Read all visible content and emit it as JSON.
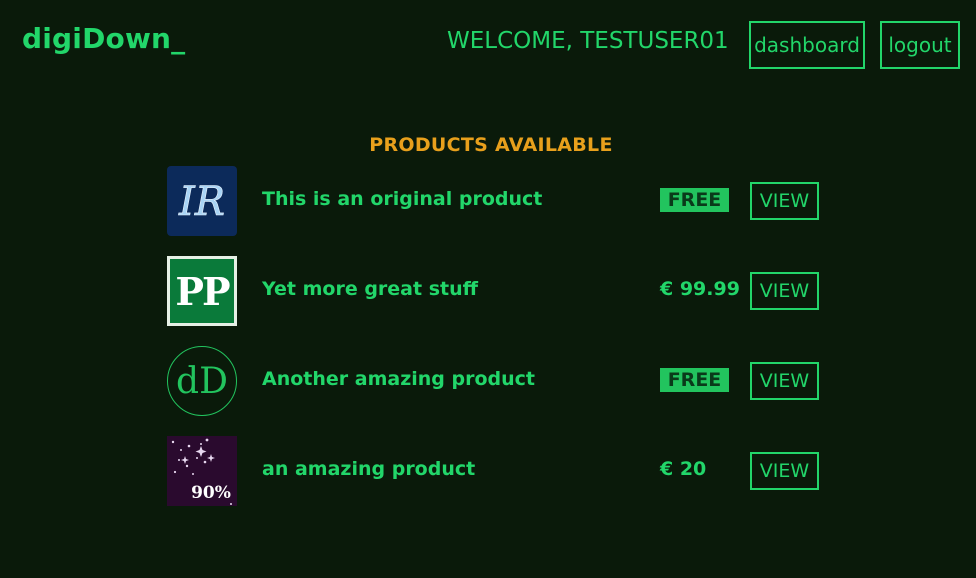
{
  "header": {
    "brand": "digiDown_",
    "welcome": "WELCOME, TESTUSER01",
    "dashboard_label": "dashboard",
    "logout_label": "logout"
  },
  "main": {
    "section_title": "PRODUCTS AVAILABLE",
    "products": [
      {
        "name": "This is an original product",
        "price": "FREE",
        "thumb_text": "IR",
        "view_label": "VIEW"
      },
      {
        "name": "Yet more great stuff",
        "price": "€ 99.99",
        "thumb_text": "PP",
        "view_label": "VIEW"
      },
      {
        "name": "Another amazing product",
        "price": "FREE",
        "thumb_text": "dD",
        "view_label": "VIEW"
      },
      {
        "name": "an amazing product",
        "price": "€ 20",
        "thumb_text": "90%",
        "view_label": "VIEW"
      }
    ]
  },
  "colors": {
    "background": "#0a1a0a",
    "accent": "#22d66a",
    "title": "#e8a01c",
    "free_badge": "#22c45e"
  }
}
